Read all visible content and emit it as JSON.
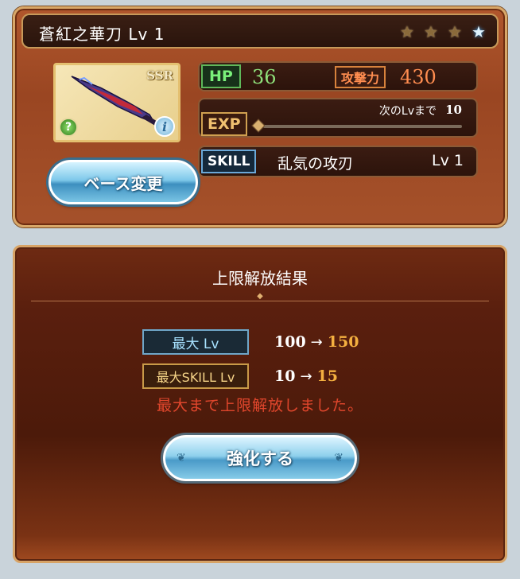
{
  "weapon": {
    "name": "蒼紅之華刀 Lv 1",
    "rarity": "SSR",
    "element_icon": "wind-element-icon",
    "info_icon": "info-icon",
    "uncap_stars": {
      "filled": 3,
      "total": 4
    }
  },
  "stats": {
    "hp_label": "HP",
    "hp_value": "36",
    "atk_label": "攻撃力",
    "atk_value": "430",
    "exp_label": "EXP",
    "next_lv_label": "次のLvまで",
    "next_lv_value": "10",
    "exp_progress": 0
  },
  "skill": {
    "label": "SKILL",
    "name": "乱気の攻刃",
    "level": "Lv 1"
  },
  "buttons": {
    "base_change": "ベース変更",
    "enhance": "強化する"
  },
  "result": {
    "title": "上限解放結果",
    "max_lv_label": "最大 Lv",
    "max_lv_from": "100",
    "max_lv_to": "150",
    "max_skill_label": "最大SKILL Lv",
    "max_skill_from": "10",
    "max_skill_to": "15",
    "arrow": "→",
    "message": "最大まで上限解放しました。"
  },
  "colors": {
    "panel_border": "#d8a768",
    "hp": "#8fe07a",
    "atk": "#ff8d50",
    "upgrade_value": "#f4b040",
    "message": "#e0462c"
  }
}
